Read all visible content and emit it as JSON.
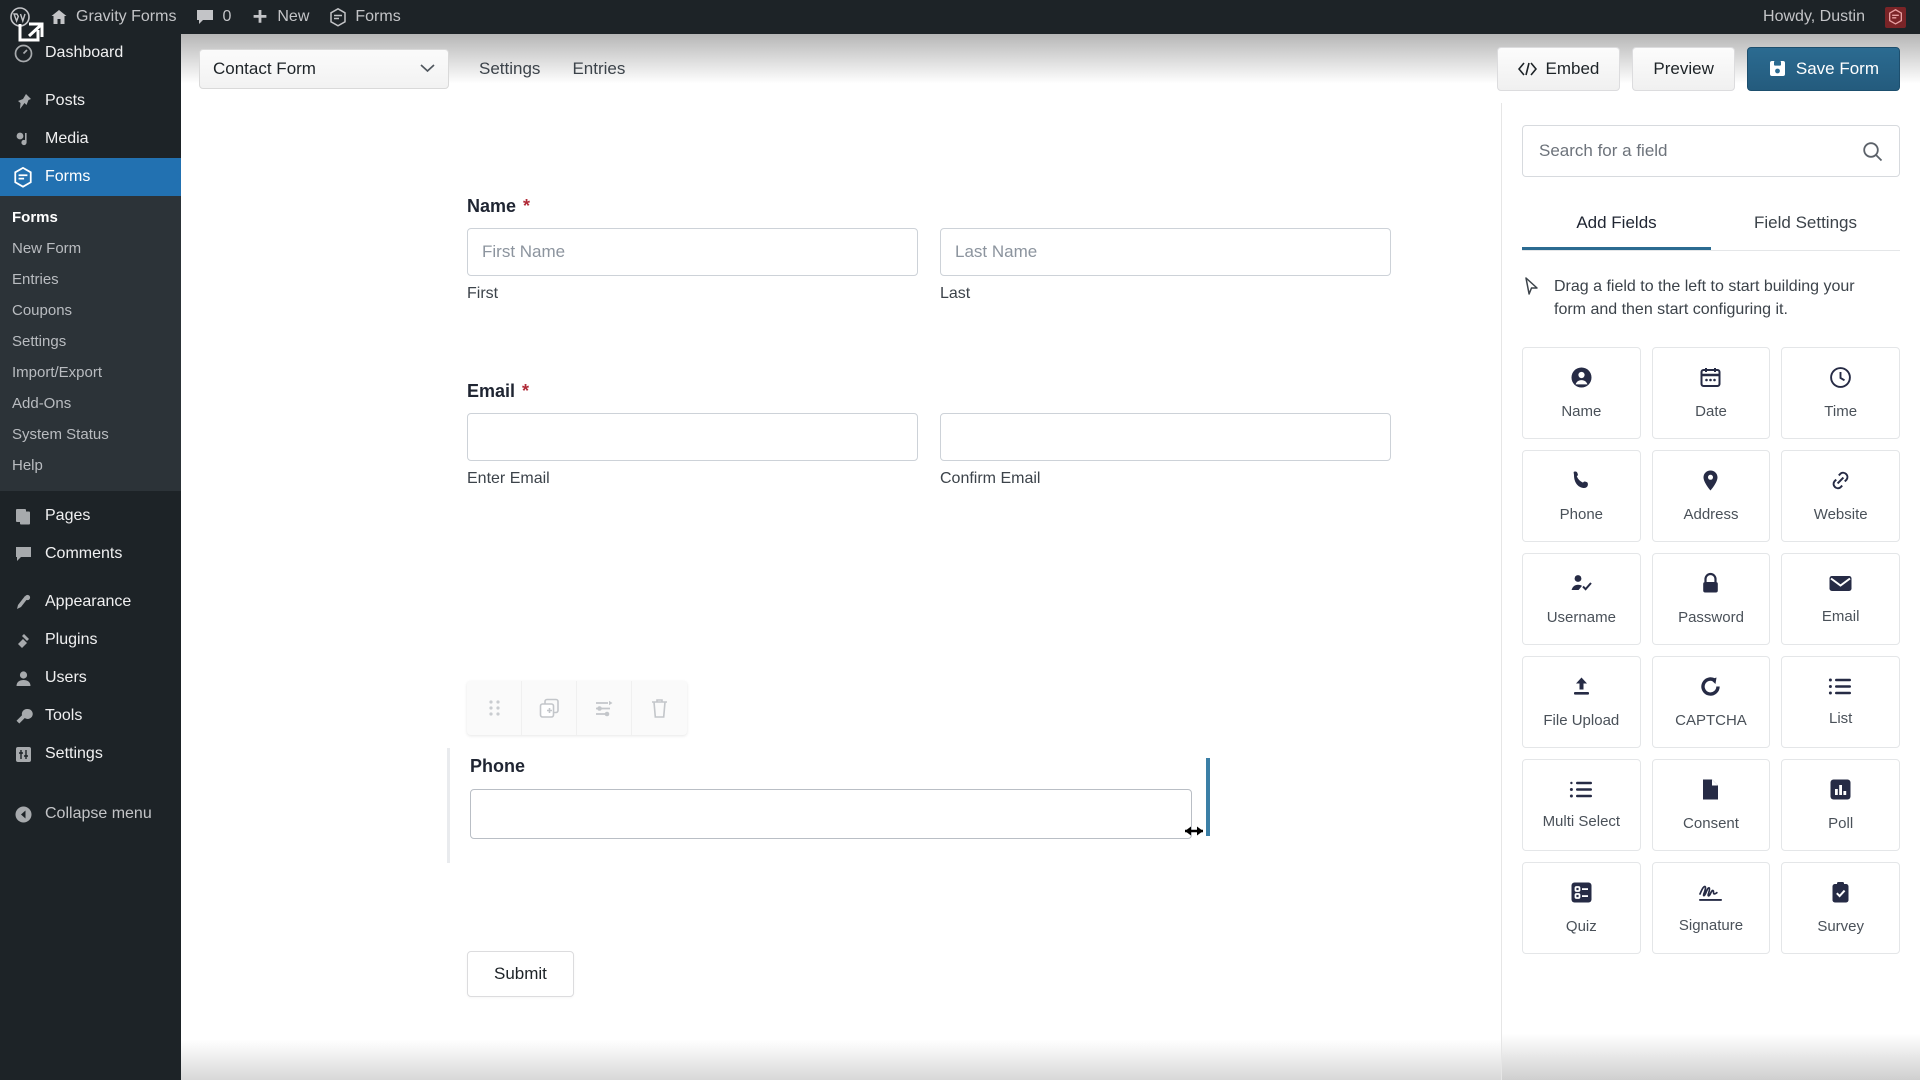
{
  "adminbar": {
    "site_name": "Gravity Forms",
    "comments_count": "0",
    "new_label": "New",
    "forms_label": "Forms",
    "howdy": "Howdy, Dustin"
  },
  "sidebar": {
    "items": [
      {
        "label": "Dashboard",
        "icon": "dashboard-icon",
        "active": false
      },
      {
        "label": "Posts",
        "icon": "pin-icon",
        "active": false
      },
      {
        "label": "Media",
        "icon": "media-icon",
        "active": false
      },
      {
        "label": "Forms",
        "icon": "gravity-forms-icon",
        "active": true
      },
      {
        "label": "Pages",
        "icon": "pages-icon",
        "active": false
      },
      {
        "label": "Comments",
        "icon": "comment-icon",
        "active": false
      },
      {
        "label": "Appearance",
        "icon": "brush-icon",
        "active": false
      },
      {
        "label": "Plugins",
        "icon": "plug-icon",
        "active": false
      },
      {
        "label": "Users",
        "icon": "user-icon",
        "active": false
      },
      {
        "label": "Tools",
        "icon": "wrench-icon",
        "active": false
      },
      {
        "label": "Settings",
        "icon": "settings-icon",
        "active": false
      }
    ],
    "submenu": [
      {
        "label": "Forms",
        "current": true
      },
      {
        "label": "New Form",
        "current": false
      },
      {
        "label": "Entries",
        "current": false
      },
      {
        "label": "Coupons",
        "current": false
      },
      {
        "label": "Settings",
        "current": false
      },
      {
        "label": "Import/Export",
        "current": false
      },
      {
        "label": "Add-Ons",
        "current": false
      },
      {
        "label": "System Status",
        "current": false
      },
      {
        "label": "Help",
        "current": false
      }
    ],
    "collapse_label": "Collapse menu"
  },
  "toolbar": {
    "form_name": "Contact Form",
    "tabs": [
      {
        "label": "Settings"
      },
      {
        "label": "Entries"
      }
    ],
    "embed_label": "Embed",
    "preview_label": "Preview",
    "save_label": "Save Form",
    "accent_color": "#2b6b91"
  },
  "form": {
    "fields": [
      {
        "label": "Name",
        "required": true,
        "columns": [
          {
            "placeholder": "First Name",
            "sublabel": "First"
          },
          {
            "placeholder": "Last Name",
            "sublabel": "Last"
          }
        ]
      },
      {
        "label": "Email",
        "required": true,
        "columns": [
          {
            "placeholder": "",
            "sublabel": "Enter Email"
          },
          {
            "placeholder": "",
            "sublabel": "Confirm Email"
          }
        ]
      }
    ],
    "active_field": {
      "label": "Phone",
      "required": false,
      "toolbar_icons": [
        "drag-handle-icon",
        "duplicate-icon",
        "field-settings-icon",
        "delete-icon"
      ],
      "resize_active": true
    },
    "submit_label": "Submit"
  },
  "panel": {
    "search_placeholder": "Search for a field",
    "search_icon": "search-icon",
    "tabs": [
      {
        "label": "Add Fields",
        "active": true
      },
      {
        "label": "Field Settings",
        "active": false
      }
    ],
    "hint": "Drag a field to the left to start building your form and then start configuring it.",
    "hint_icon": "cursor-arrow-icon",
    "fields": [
      {
        "label": "Name",
        "icon": "person-circle-icon"
      },
      {
        "label": "Date",
        "icon": "calendar-icon"
      },
      {
        "label": "Time",
        "icon": "clock-icon"
      },
      {
        "label": "Phone",
        "icon": "phone-icon"
      },
      {
        "label": "Address",
        "icon": "map-pin-icon"
      },
      {
        "label": "Website",
        "icon": "link-icon"
      },
      {
        "label": "Username",
        "icon": "user-check-icon"
      },
      {
        "label": "Password",
        "icon": "lock-icon"
      },
      {
        "label": "Email",
        "icon": "envelope-icon"
      },
      {
        "label": "File Upload",
        "icon": "upload-icon"
      },
      {
        "label": "CAPTCHA",
        "icon": "refresh-icon"
      },
      {
        "label": "List",
        "icon": "list-icon"
      },
      {
        "label": "Multi Select",
        "icon": "multi-select-icon"
      },
      {
        "label": "Consent",
        "icon": "document-icon"
      },
      {
        "label": "Poll",
        "icon": "bar-chart-icon"
      },
      {
        "label": "Quiz",
        "icon": "quiz-icon"
      },
      {
        "label": "Signature",
        "icon": "signature-icon"
      },
      {
        "label": "Survey",
        "icon": "clipboard-check-icon"
      }
    ]
  }
}
